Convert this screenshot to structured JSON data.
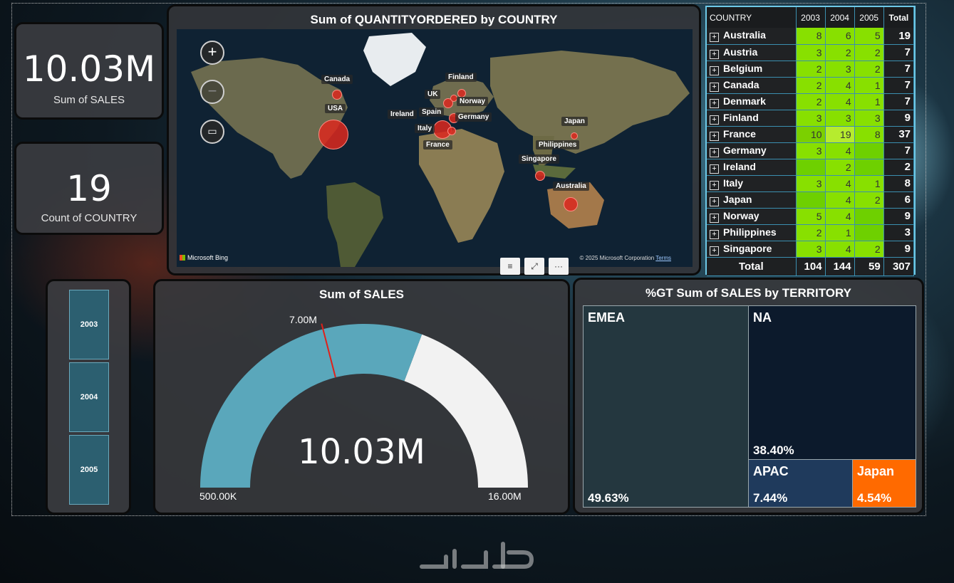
{
  "kpi_sales": {
    "value": "10.03M",
    "label": "Sum of SALES"
  },
  "kpi_country": {
    "value": "19",
    "label": "Count of COUNTRY"
  },
  "map": {
    "title": "Sum of QUANTITYORDERED by COUNTRY",
    "zoom_in": "+",
    "zoom_out": "−",
    "labels": {
      "canada": "Canada",
      "usa": "USA",
      "finland": "Finland",
      "uk": "UK",
      "norway": "Norway",
      "ireland": "Ireland",
      "spain": "Spain",
      "germany": "Germany",
      "italy": "Italy",
      "france": "France",
      "japan": "Japan",
      "philippines": "Philippines",
      "singapore": "Singapore",
      "australia": "Australia"
    },
    "footer_brand": "Microsoft Bing",
    "footer_copyright": "© 2025 Microsoft Corporation",
    "footer_terms": "Terms"
  },
  "matrix": {
    "header_country": "COUNTRY",
    "years": [
      "2003",
      "2004",
      "2005"
    ],
    "header_total": "Total",
    "rows": [
      {
        "country": "Australia",
        "v": [
          "8",
          "6",
          "5"
        ],
        "total": "19"
      },
      {
        "country": "Austria",
        "v": [
          "3",
          "2",
          "2"
        ],
        "total": "7"
      },
      {
        "country": "Belgium",
        "v": [
          "2",
          "3",
          "2"
        ],
        "total": "7"
      },
      {
        "country": "Canada",
        "v": [
          "2",
          "4",
          "1"
        ],
        "total": "7"
      },
      {
        "country": "Denmark",
        "v": [
          "2",
          "4",
          "1"
        ],
        "total": "7"
      },
      {
        "country": "Finland",
        "v": [
          "3",
          "3",
          "3"
        ],
        "total": "9"
      },
      {
        "country": "France",
        "v": [
          "10",
          "19",
          "8"
        ],
        "total": "37"
      },
      {
        "country": "Germany",
        "v": [
          "3",
          "4",
          ""
        ],
        "total": "7"
      },
      {
        "country": "Ireland",
        "v": [
          "",
          "2",
          ""
        ],
        "total": "2"
      },
      {
        "country": "Italy",
        "v": [
          "3",
          "4",
          "1"
        ],
        "total": "8"
      },
      {
        "country": "Japan",
        "v": [
          "",
          "4",
          "2"
        ],
        "total": "6"
      },
      {
        "country": "Norway",
        "v": [
          "5",
          "4",
          ""
        ],
        "total": "9"
      },
      {
        "country": "Philippines",
        "v": [
          "2",
          "1",
          ""
        ],
        "total": "3"
      },
      {
        "country": "Singapore",
        "v": [
          "3",
          "4",
          "2"
        ],
        "total": "9"
      }
    ],
    "total_row": {
      "label": "Total",
      "v": [
        "104",
        "144",
        "59"
      ],
      "total": "307"
    }
  },
  "slicer": {
    "options": [
      "2003",
      "2004",
      "2005"
    ]
  },
  "gauge": {
    "title": "Sum of SALES",
    "value_label": "10.03M",
    "min_label": "500.00K",
    "max_label": "16.00M",
    "target_label": "7.00M",
    "min": 500000,
    "max": 16000000,
    "value": 10030000,
    "target": 7000000,
    "fill_color": "#5aa7bb",
    "rest_color": "#f2f2f2",
    "target_color": "#e0201a"
  },
  "treemap": {
    "title": "%GT Sum of SALES by TERRITORY",
    "items": [
      {
        "name": "EMEA",
        "pct": "49.63%",
        "color": "#24373f"
      },
      {
        "name": "NA",
        "pct": "38.40%",
        "color": "#0c1a2c"
      },
      {
        "name": "APAC",
        "pct": "7.44%",
        "color": "#1f3a5c"
      },
      {
        "name": "Japan",
        "pct": "4.54%",
        "color": "#ff6a00"
      }
    ]
  }
}
